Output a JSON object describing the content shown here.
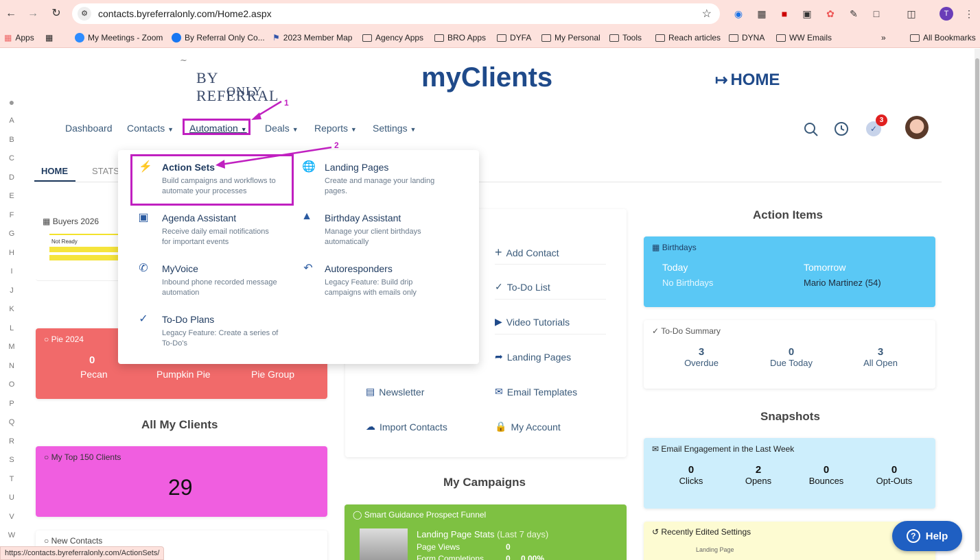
{
  "browser": {
    "url": "contacts.byreferralonly.com/Home2.aspx",
    "status_url": "https://contacts.byreferralonly.com/ActionSets/",
    "profile_initial": "T",
    "bookmarks": [
      "Apps",
      "My Meetings - Zoom",
      "By Referral Only Co...",
      "2023 Member Map",
      "Agency Apps",
      "BRO Apps",
      "DYFA",
      "My Personal",
      "Tools",
      "Reach articles",
      "DYNA",
      "WW Emails"
    ],
    "all_bookmarks": "All Bookmarks",
    "more": "»"
  },
  "header": {
    "logo_top": "By Referral",
    "logo_bottom": "Only",
    "app_title": "myClients",
    "home_link": "HOME",
    "notification_count": "3"
  },
  "nav": {
    "items": [
      "Dashboard",
      "Contacts",
      "Automation",
      "Deals",
      "Reports",
      "Settings"
    ]
  },
  "annotations": {
    "step1": "1",
    "step2": "2"
  },
  "alphabet": [
    "A",
    "B",
    "C",
    "D",
    "E",
    "F",
    "G",
    "H",
    "I",
    "J",
    "K",
    "L",
    "M",
    "N",
    "O",
    "P",
    "Q",
    "R",
    "S",
    "T",
    "U",
    "V",
    "W"
  ],
  "tabs": {
    "home": "HOME",
    "stats": "STATS"
  },
  "dropdown": {
    "items": [
      {
        "title": "Action Sets",
        "desc1": "Build campaigns and workflows to",
        "desc2": "automate your processes",
        "icon": "bolt-icon"
      },
      {
        "title": "Landing Pages",
        "desc1": "Create and manage your landing",
        "desc2": "pages.",
        "icon": "globe-icon"
      },
      {
        "title": "Agenda Assistant",
        "desc1": "Receive daily email notifications",
        "desc2": "for important events",
        "icon": "calendar-icon"
      },
      {
        "title": "Birthday Assistant",
        "desc1": "Manage your client birthdays",
        "desc2": "automatically",
        "icon": "cake-icon"
      },
      {
        "title": "MyVoice",
        "desc1": "Inbound phone recorded message",
        "desc2": "automation",
        "icon": "phone-icon"
      },
      {
        "title": "Autoresponders",
        "desc1": "Legacy Feature: Build drip",
        "desc2": "campaigns with emails only",
        "icon": "reply-icon"
      },
      {
        "title": "To-Do Plans",
        "desc1": "Legacy Feature: Create a series of",
        "desc2": "To-Do's",
        "icon": "checklist-icon"
      }
    ]
  },
  "left": {
    "buyers_title": "Buyers 2026",
    "not_ready": "Not Ready",
    "pie": {
      "title": "Pie 2024",
      "count": "0",
      "labels": [
        "Pecan",
        "Pumpkin Pie",
        "Pie Group"
      ]
    },
    "all_my_clients": "All My Clients",
    "top150": {
      "title": "My Top 150 Clients",
      "count": "29"
    },
    "new_contacts": "New Contacts"
  },
  "shortcuts": {
    "add_contact": "Add Contact",
    "todo_list": "To-Do List",
    "video_tutorials": "Video Tutorials",
    "landing_pages": "Landing Pages",
    "newsletter": "Newsletter",
    "email_templates": "Email Templates",
    "import_contacts": "Import Contacts",
    "my_account": "My Account"
  },
  "campaigns": {
    "title": "My Campaigns",
    "funnel_title": "Smart Guidance Prospect Funnel",
    "stats_title": "Landing Page Stats",
    "stats_period": "(Last 7 days)",
    "page_views_label": "Page Views",
    "page_views_value": "0",
    "form_label": "Form Completions",
    "form_value": "0",
    "form_pct": "0.00%"
  },
  "action_items": {
    "title": "Action Items",
    "birthdays_title": "Birthdays",
    "today_label": "Today",
    "today_value": "No Birthdays",
    "tomorrow_label": "Tomorrow",
    "tomorrow_value": "Mario Martinez (54)",
    "todo_title": "To-Do Summary",
    "todo": [
      {
        "num": "3",
        "label": "Overdue"
      },
      {
        "num": "0",
        "label": "Due Today"
      },
      {
        "num": "3",
        "label": "All Open"
      }
    ]
  },
  "snapshots": {
    "title": "Snapshots",
    "email_title": "Email Engagement in the Last Week",
    "stats": [
      {
        "num": "0",
        "label": "Clicks"
      },
      {
        "num": "2",
        "label": "Opens"
      },
      {
        "num": "0",
        "label": "Bounces"
      },
      {
        "num": "0",
        "label": "Opt-Outs"
      }
    ],
    "recent_title": "Recently Edited Settings",
    "recent_item": "Landing Page"
  },
  "help": {
    "label": "Help"
  },
  "colors": {
    "accent_purple": "#c020c0",
    "pie_card": "#f16a6a",
    "top150_card": "#f05ee0",
    "birthday_card": "#5ac8f5",
    "snapshot_card": "#cdeefc",
    "campaign_green": "#7ec142",
    "help_blue": "#1f5fc2"
  }
}
